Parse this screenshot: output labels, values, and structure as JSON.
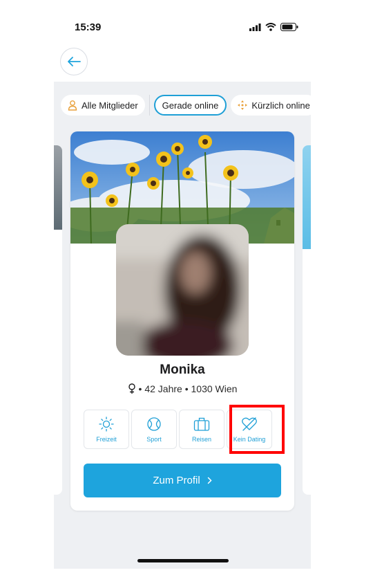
{
  "status": {
    "time": "15:39"
  },
  "filters": [
    {
      "label": "Alle Mitglieder",
      "icon": "person-icon"
    },
    {
      "label": "Gerade online",
      "active": true
    },
    {
      "label": "Kürzlich online",
      "icon": "move-icon"
    }
  ],
  "profile": {
    "name": "Monika",
    "gender_icon": "female-icon",
    "details": "• 42 Jahre • 1030 Wien",
    "interests": [
      {
        "label": "Freizeit",
        "icon": "sun-icon"
      },
      {
        "label": "Sport",
        "icon": "ball-icon"
      },
      {
        "label": "Reisen",
        "icon": "suitcase-icon"
      },
      {
        "label": "Kein Dating",
        "icon": "no-dating-icon"
      }
    ],
    "profile_button": "Zum Profil",
    "profile_button_icon": "chevron-right-icon"
  },
  "colors": {
    "accent": "#1ea4dd",
    "highlight": "#ff0000",
    "background": "#eef0f3"
  }
}
